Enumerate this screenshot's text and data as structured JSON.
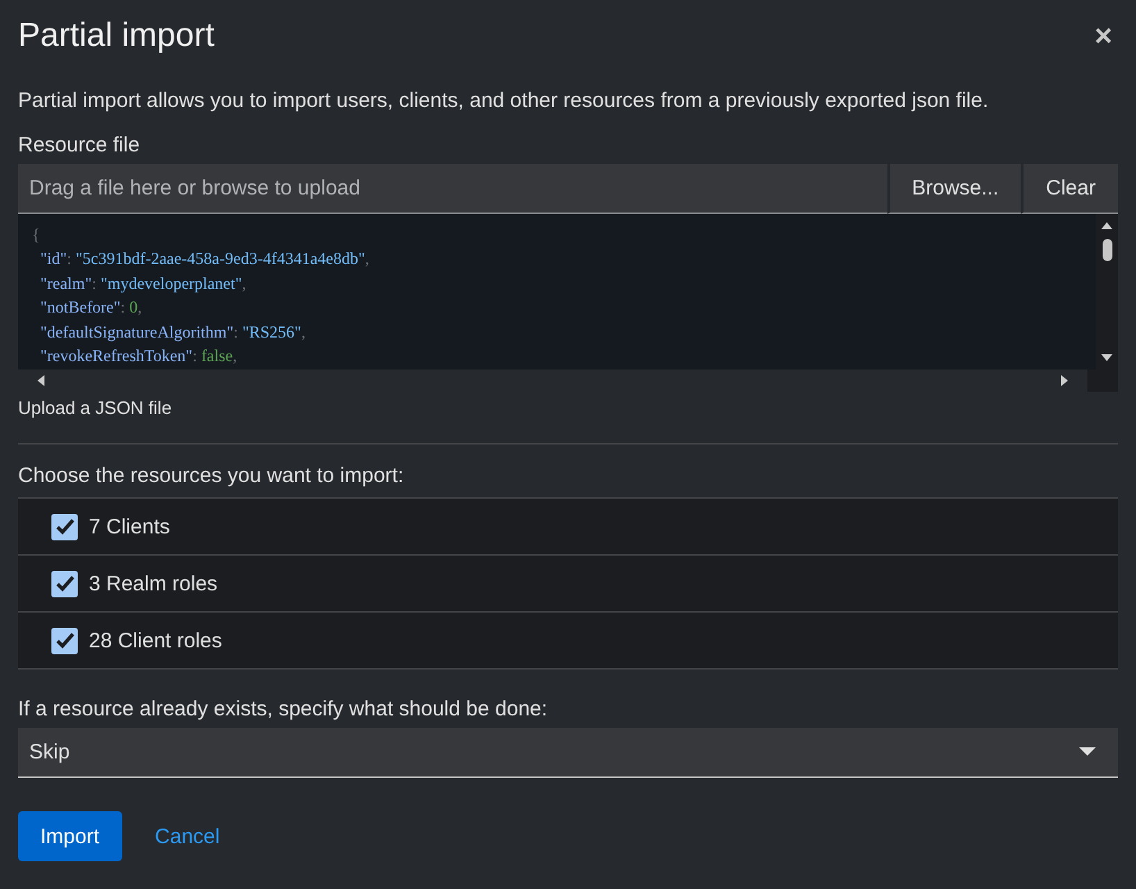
{
  "title": "Partial import",
  "close": "×",
  "description": "Partial import allows you to import users, clients, and other resources from a previously exported json file.",
  "resource_file": {
    "label": "Resource file",
    "placeholder": "Drag a file here or browse to upload",
    "buttons": [
      "Browse...",
      "Clear"
    ],
    "code_lines": [
      [
        {
          "kind": "punct",
          "text": "{"
        }
      ],
      [
        {
          "kind": "key",
          "text": "  \"id\""
        },
        {
          "kind": "punct",
          "text": ": "
        },
        {
          "kind": "string",
          "text": "\"5c391bdf-2aae-458a-9ed3-4f4341a4e8db\""
        },
        {
          "kind": "punct",
          "text": ","
        }
      ],
      [
        {
          "kind": "key",
          "text": "  \"realm\""
        },
        {
          "kind": "punct",
          "text": ": "
        },
        {
          "kind": "string",
          "text": "\"mydeveloperplanet\""
        },
        {
          "kind": "punct",
          "text": ","
        }
      ],
      [
        {
          "kind": "key",
          "text": "  \"notBefore\""
        },
        {
          "kind": "punct",
          "text": ": "
        },
        {
          "kind": "number",
          "text": "0"
        },
        {
          "kind": "punct",
          "text": ","
        }
      ],
      [
        {
          "kind": "key",
          "text": "  \"defaultSignatureAlgorithm\""
        },
        {
          "kind": "punct",
          "text": ": "
        },
        {
          "kind": "string",
          "text": "\"RS256\""
        },
        {
          "kind": "punct",
          "text": ","
        }
      ],
      [
        {
          "kind": "key",
          "text": "  \"revokeRefreshToken\""
        },
        {
          "kind": "punct",
          "text": ": "
        },
        {
          "kind": "number",
          "text": "false"
        },
        {
          "kind": "punct",
          "text": ","
        }
      ]
    ],
    "helper": "Upload a JSON file"
  },
  "resources": {
    "label": "Choose the resources you want to import:",
    "items": [
      {
        "label": "7 Clients",
        "checked": true
      },
      {
        "label": "3 Realm roles",
        "checked": true
      },
      {
        "label": "28 Client roles",
        "checked": true
      }
    ]
  },
  "policy": {
    "label": "If a resource already exists, specify what should be done:",
    "value": "Skip"
  },
  "actions": {
    "primary": "Import",
    "link": "Cancel"
  }
}
